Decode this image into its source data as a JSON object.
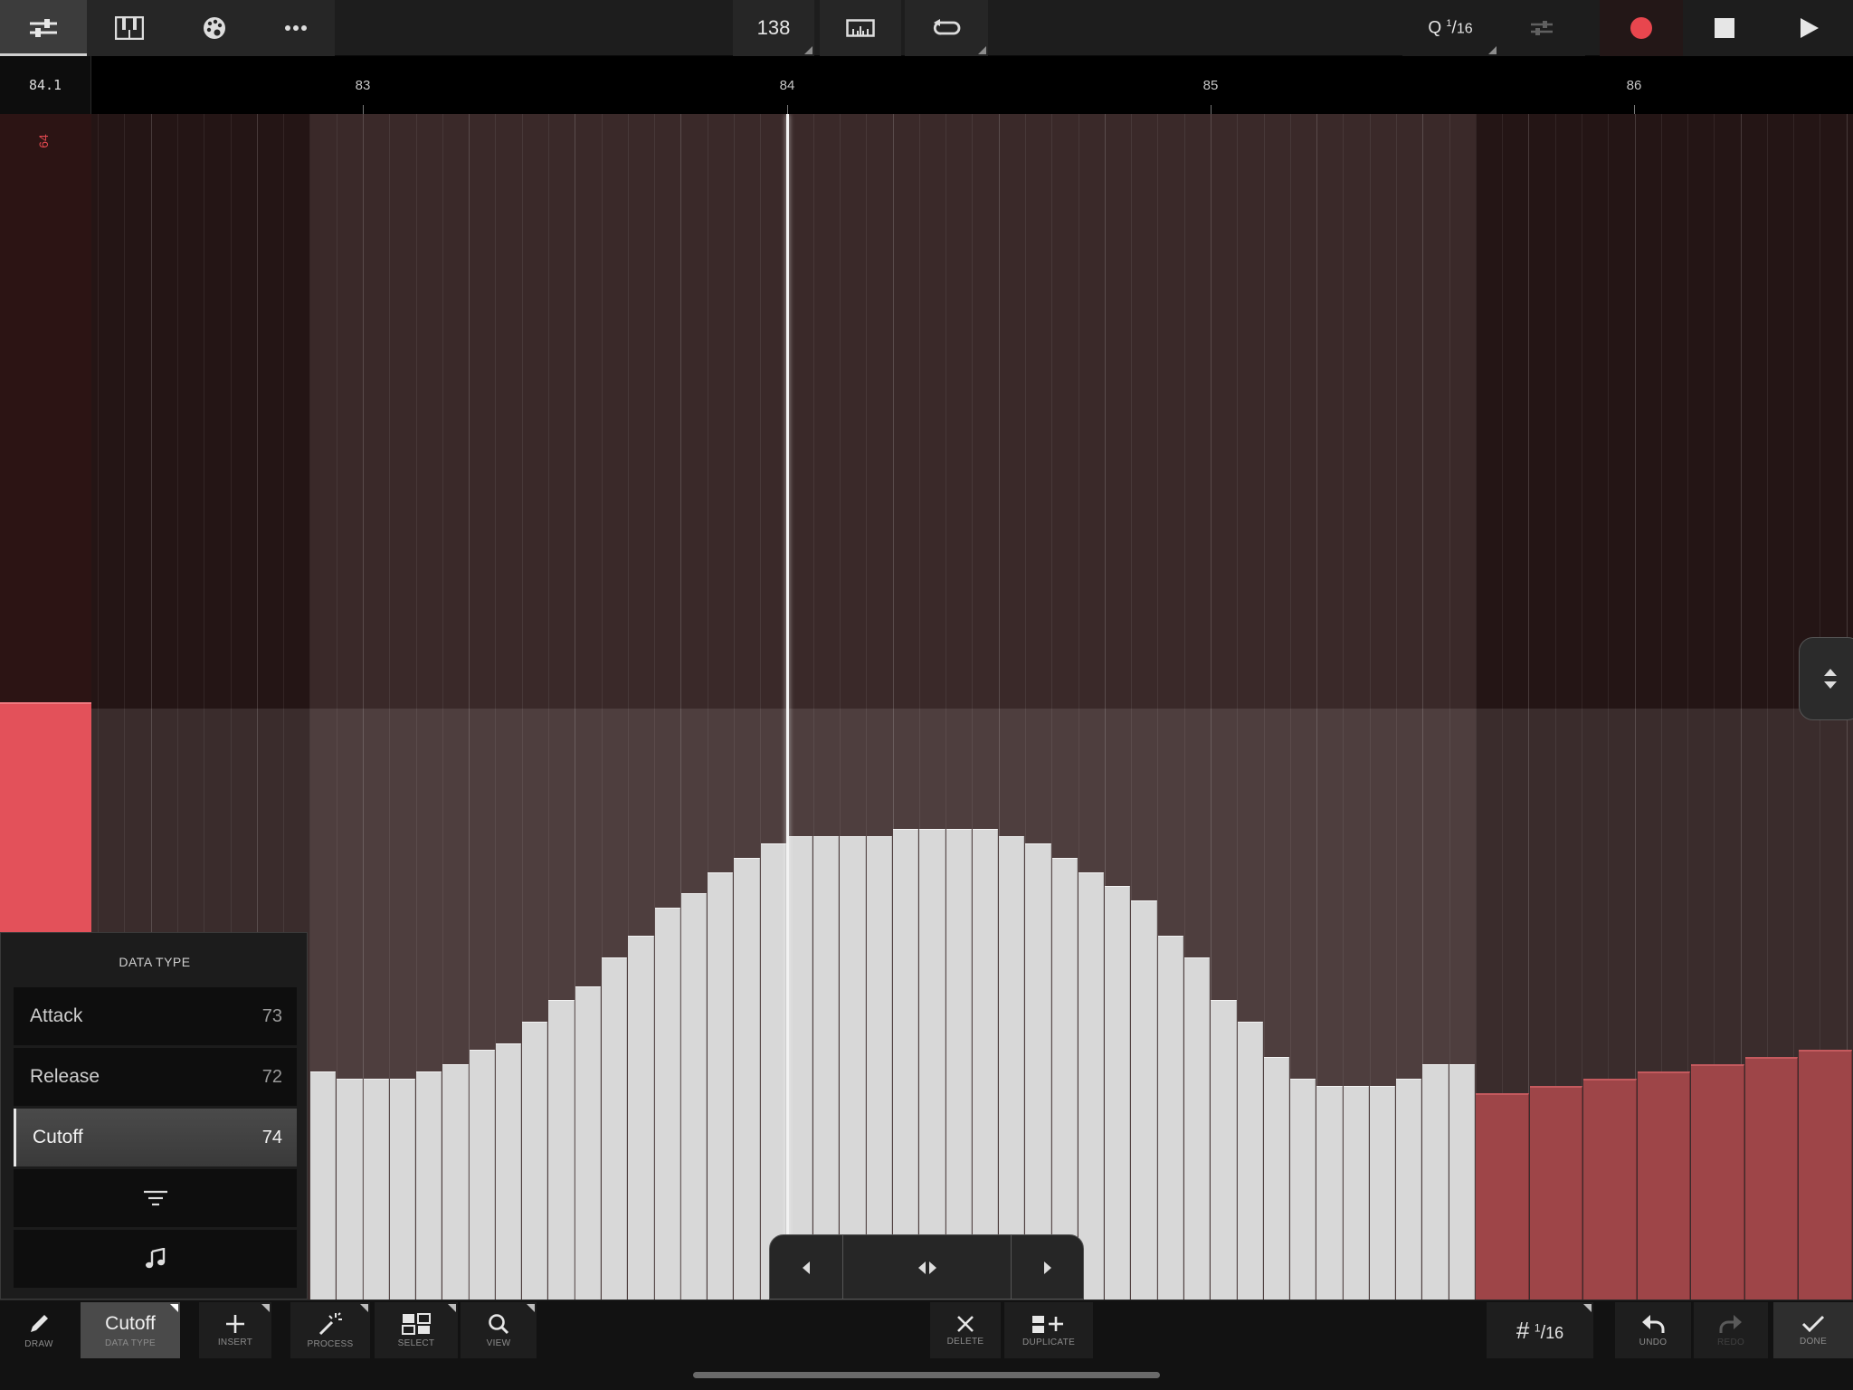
{
  "top_toolbar": {
    "tempo": "138",
    "quantize": {
      "prefix": "Q",
      "numerator": "1",
      "denominator": "16"
    },
    "icons": [
      "mixer-icon",
      "piano-keys-icon",
      "palette-icon",
      "more-icon",
      "metronome-ruler-icon",
      "loop-icon",
      "quantize-toggle-icon",
      "record-icon",
      "stop-icon",
      "play-icon"
    ],
    "record_color": "#e8464e"
  },
  "ruler": {
    "position": "84.1",
    "bars": [
      "83",
      "84",
      "85",
      "86"
    ]
  },
  "editor": {
    "value_label": "64",
    "accent_color": "#e3515a",
    "selected_bar_color": "#d8d8d8",
    "unselected_bar_color": "#9e4548"
  },
  "chart_data": {
    "type": "bar",
    "x": [
      "83",
      "84",
      "85",
      "86"
    ],
    "ylim": [
      0,
      127
    ],
    "series": [
      {
        "values": [
          63,
          63,
          63,
          63,
          63,
          63,
          63,
          63,
          63,
          63,
          63,
          63,
          63,
          63,
          63,
          63,
          63,
          63,
          63,
          63,
          63,
          63,
          63,
          63,
          63,
          63,
          63,
          63,
          63,
          63,
          63,
          63,
          63,
          63,
          63,
          63,
          63,
          63,
          63,
          63,
          63,
          63,
          63,
          63,
          63,
          63,
          63,
          63,
          63,
          63,
          63,
          63,
          63,
          63,
          63,
          63,
          63,
          63,
          63,
          63,
          63,
          63,
          63,
          63,
          63,
          63,
          63,
          63,
          63,
          63,
          63,
          63,
          63,
          63,
          63,
          63,
          63,
          63,
          63,
          63,
          63,
          63,
          63,
          63,
          63,
          63,
          63,
          63,
          63,
          63,
          63,
          63,
          63,
          63,
          63,
          63,
          63,
          63,
          63,
          63,
          63,
          63,
          63,
          63,
          63,
          63,
          63,
          63,
          63,
          63,
          63,
          63,
          63,
          63,
          63,
          63,
          63,
          63,
          63,
          63,
          63,
          63,
          63,
          63,
          63,
          63,
          63,
          63,
          63,
          63,
          63,
          63,
          63,
          63,
          63,
          63,
          63,
          63,
          63,
          63,
          63,
          63,
          63,
          63,
          63,
          63,
          63,
          63,
          63,
          63,
          63,
          63,
          63,
          63,
          63,
          63,
          63,
          63,
          63,
          63,
          63,
          63,
          63,
          63,
          63,
          63,
          63,
          63,
          63,
          63,
          63,
          63,
          63,
          63,
          63,
          63,
          63,
          63,
          63,
          63,
          63,
          63,
          63,
          63,
          63,
          63,
          63,
          63,
          63,
          63,
          63,
          63,
          63,
          63,
          63,
          63,
          63,
          63,
          63,
          63,
          63,
          63,
          63,
          63,
          63,
          63,
          63,
          63,
          63,
          63
        ]
      }
    ],
    "selected_steps": {
      "values": [
        32,
        31,
        31,
        31,
        32,
        33,
        35,
        36,
        39,
        42,
        44,
        48,
        51,
        55,
        57,
        60,
        62,
        64,
        65,
        65,
        65,
        65,
        66,
        66,
        66,
        66,
        65,
        64,
        62,
        60,
        58,
        56,
        51,
        48,
        42,
        39,
        34,
        31,
        30,
        30,
        30,
        31,
        33,
        33
      ]
    },
    "unselected_steps": {
      "values": [
        35,
        34,
        33,
        32,
        31,
        30,
        29
      ]
    }
  },
  "datatype_panel": {
    "title": "DATA TYPE",
    "items": [
      {
        "name": "Attack",
        "cc": "73"
      },
      {
        "name": "Release",
        "cc": "72"
      },
      {
        "name": "Cutoff",
        "cc": "74"
      }
    ],
    "filter_icon": "filter-icon",
    "note_icon": "music-note-icon"
  },
  "bottom_toolbar": {
    "draw": "DRAW",
    "data_type_value": "Cutoff",
    "data_type": "DATA TYPE",
    "insert": "INSERT",
    "process": "PROCESS",
    "select": "SELECT",
    "view": "VIEW",
    "delete": "DELETE",
    "duplicate": "DUPLICATE",
    "grid": {
      "symbol": "#",
      "numerator": "1",
      "denominator": "16"
    },
    "undo": "UNDO",
    "redo": "REDO",
    "done": "DONE"
  }
}
